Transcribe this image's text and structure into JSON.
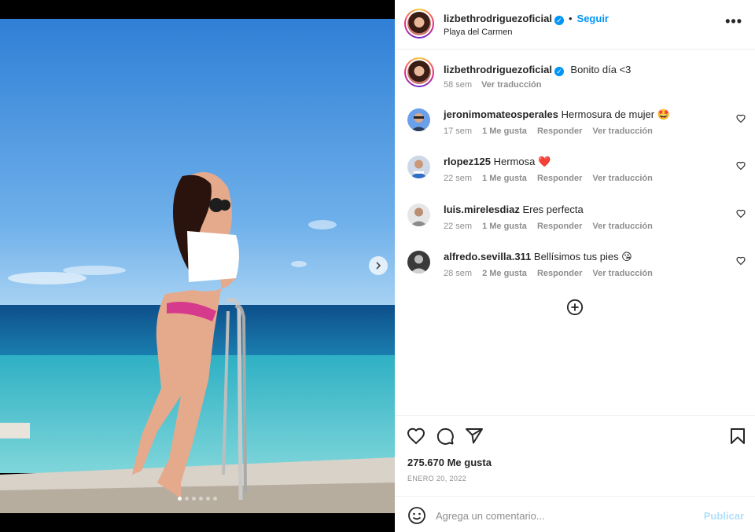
{
  "post": {
    "username": "lizbethrodriguezoficial",
    "follow_label": "Seguir",
    "location": "Playa del Carmen",
    "more_label": "•••",
    "caption_text": "Bonito día <3",
    "caption_time": "58 sem",
    "caption_translate": "Ver traducción",
    "image_count": 6,
    "active_image_index": 0
  },
  "comments": [
    {
      "username": "jeronimomateosperales",
      "text": "Hermosura de mujer 🤩",
      "time": "17 sem",
      "likes": "1 Me gusta",
      "reply": "Responder",
      "translate": "Ver traducción"
    },
    {
      "username": "rlopez125",
      "text": "Hermosa ❤️",
      "time": "22 sem",
      "likes": "1 Me gusta",
      "reply": "Responder",
      "translate": "Ver traducción"
    },
    {
      "username": "luis.mirelesdiaz",
      "text": "Eres perfecta",
      "time": "22 sem",
      "likes": "1 Me gusta",
      "reply": "Responder",
      "translate": "Ver traducción"
    },
    {
      "username": "alfredo.sevilla.311",
      "text": "Bellísimos tus pies 😘",
      "time": "28 sem",
      "likes": "2 Me gusta",
      "reply": "Responder",
      "translate": "Ver traducción"
    }
  ],
  "footer": {
    "likes_count": "275.670 Me gusta",
    "date": "ENERO 20, 2022",
    "comment_placeholder": "Agrega un comentario...",
    "publish_label": "Publicar"
  },
  "colors": {
    "accent": "#0095f6",
    "muted": "#8e8e8e",
    "publish_disabled": "#b2dffc"
  }
}
